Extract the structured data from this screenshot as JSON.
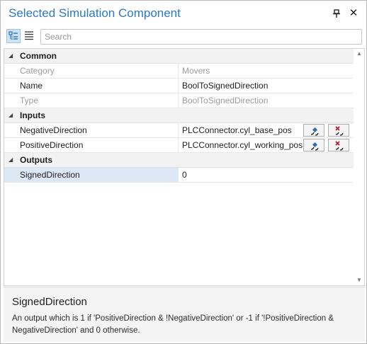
{
  "window": {
    "title": "Selected Simulation Component",
    "pin_icon": "pin-icon",
    "close_glyph": "✕"
  },
  "toolbar": {
    "categorized_icon": "categorized-view-icon",
    "alphabetical_icon": "alphabetical-view-icon",
    "search_placeholder": "Search",
    "search_value": ""
  },
  "categories": [
    {
      "label": "Common",
      "arrow": "◢",
      "properties": [
        {
          "name": "Category",
          "value": "Movers",
          "readonly": true
        },
        {
          "name": "Name",
          "value": "BoolToSignedDirection",
          "readonly": false
        },
        {
          "name": "Type",
          "value": "BoolToSignedDirection",
          "readonly": true
        }
      ]
    },
    {
      "label": "Inputs",
      "arrow": "◢",
      "properties": [
        {
          "name": "NegativeDirection",
          "value": "PLCConnector.cyl_base_pos",
          "readonly": false,
          "connect": true
        },
        {
          "name": "PositiveDirection",
          "value": "PLCConnector.cyl_working_pos",
          "readonly": false,
          "connect": true
        }
      ]
    },
    {
      "label": "Outputs",
      "arrow": "◢",
      "properties": [
        {
          "name": "SignedDirection",
          "value": "0",
          "readonly": false,
          "selected": true
        }
      ]
    }
  ],
  "scrollbar": {
    "up_glyph": "▲",
    "down_glyph": "▼"
  },
  "description": {
    "title": "SignedDirection",
    "text": "An output which is 1 if 'PositiveDirection & !NegativeDirection' or -1 if '!PositiveDirection & NegativeDirection' and 0 otherwise."
  },
  "colors": {
    "title": "#2a78c6",
    "selection": "#dce8f6",
    "category_bg": "#f2f2f2"
  }
}
